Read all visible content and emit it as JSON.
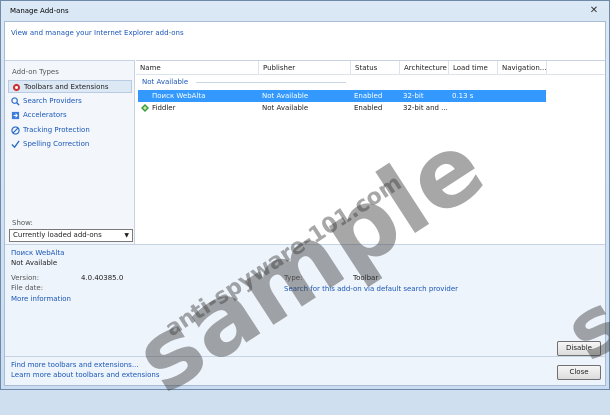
{
  "window": {
    "title": "Manage Add-ons",
    "close_glyph": "✕"
  },
  "header": {
    "link": "View and manage your Internet Explorer add-ons"
  },
  "sidebar": {
    "heading": "Add-on Types",
    "items": [
      {
        "label": "Toolbars and Extensions",
        "icon": "gear-icon"
      },
      {
        "label": "Search Providers",
        "icon": "search-icon"
      },
      {
        "label": "Accelerators",
        "icon": "accelerator-icon"
      },
      {
        "label": "Tracking Protection",
        "icon": "no-entry-icon"
      },
      {
        "label": "Spelling Correction",
        "icon": "spell-check-icon"
      }
    ],
    "show_label": "Show:",
    "show_value": "Currently loaded add-ons",
    "show_arrow": "▼"
  },
  "list": {
    "columns": [
      "Name",
      "Publisher",
      "Status",
      "Architecture",
      "Load time",
      "Navigation..."
    ],
    "group": "Not Available",
    "rows": [
      {
        "name": "Поиск WebAlta",
        "publisher": "Not Available",
        "status": "Enabled",
        "architecture": "32-bit",
        "load_time": "0.13 s",
        "navigation": "",
        "selected": true
      },
      {
        "name": "Fiddler",
        "publisher": "Not Available",
        "status": "Enabled",
        "architecture": "32-bit and ...",
        "load_time": "",
        "navigation": "",
        "selected": false
      }
    ]
  },
  "details": {
    "name": "Поиск WebAlta",
    "publisher": "Not Available",
    "version_label": "Version:",
    "version_value": "4.0.40385.0",
    "file_date_label": "File date:",
    "file_date_value": "",
    "more_info": "More information",
    "type_label": "Type:",
    "type_value": "Toolbar",
    "search_link": "Search for this add-on via default search provider"
  },
  "footer": {
    "disable_label": "Disable",
    "close_label": "Close",
    "find_more": "Find more toolbars and extensions...",
    "learn_more": "Learn more about toolbars and extensions"
  },
  "watermark": {
    "big": "sample",
    "site": "anti-spyware-101.com",
    "edge": "sa"
  }
}
